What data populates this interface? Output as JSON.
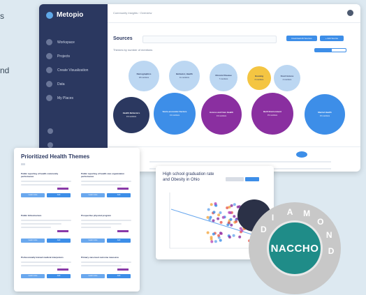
{
  "edge_text": {
    "line1": "s",
    "line2": "nd"
  },
  "app": {
    "brand": "Metopio",
    "breadcrumb": "Community Insights › Overview",
    "nav": [
      {
        "label": "Workspace"
      },
      {
        "label": "Projects"
      },
      {
        "label": "Create Visualization"
      },
      {
        "label": "Data"
      },
      {
        "label": "My Places"
      }
    ],
    "sources": {
      "title": "Sources",
      "subheading": "Themes by number of mentions",
      "button_primary": "Download All Sources",
      "button_secondary": "+ Add Source",
      "progress": 0.55
    },
    "bubbles": [
      {
        "label": "Demographics",
        "count": "18 mentions",
        "color": "#bcd7f2",
        "text": "#2b3860"
      },
      {
        "label": "Behavior, Health",
        "count": "11 mentions",
        "color": "#bcd7f2",
        "text": "#2b3860"
      },
      {
        "label": "Chronic Disease",
        "count": "7 mentions",
        "color": "#bcd7f2",
        "text": "#2b3860"
      },
      {
        "label": "Housing",
        "count": "6 mentions",
        "color": "#f4c542",
        "text": "#2b3860"
      },
      {
        "label": "Food Access",
        "count": "4 mentions",
        "color": "#bcd7f2",
        "text": "#2b3860"
      },
      {
        "label": "Health Behaviors",
        "count": "13 mentions",
        "color": "#2b3860",
        "text": "#ffffff"
      },
      {
        "label": "Socio-economic Factors",
        "count": "13 mentions",
        "color": "#3d8ee8",
        "text": "#ffffff"
      },
      {
        "label": "Access and Care Health",
        "count": "13 mentions",
        "color": "#8a2fa0",
        "text": "#ffffff"
      },
      {
        "label": "Built Environment",
        "count": "15 mentions",
        "color": "#8a2fa0",
        "text": "#ffffff"
      },
      {
        "label": "Mental Health",
        "count": "15 mentions",
        "color": "#3d8ee8",
        "text": "#ffffff"
      }
    ]
  },
  "prioritized": {
    "title": "Prioritized Health Themes",
    "items": [
      {
        "title": "Public reporting of health community performance",
        "btn1": "Learn more",
        "btn2": "Add"
      },
      {
        "title": "Public reporting of health care organization performance",
        "btn1": "Learn more",
        "btn2": "Add"
      },
      {
        "title": "Public Infrastructure",
        "btn1": "Learn more",
        "btn2": "Add"
      },
      {
        "title": "Prospective physical program",
        "btn1": "Learn more",
        "btn2": "Add"
      },
      {
        "title": "Professionally trained medical interpreters",
        "btn1": "Learn more",
        "btn2": "Add"
      },
      {
        "title": "Primary care-level outcome measures",
        "btn1": "Learn more",
        "btn2": "Add"
      }
    ]
  },
  "scatter": {
    "title": "High school graduation rate and Obesity in Ohio"
  },
  "seal": {
    "text": "NACCHO",
    "ring": [
      "D",
      "I",
      "A",
      "M",
      "O",
      "N",
      "D"
    ]
  }
}
